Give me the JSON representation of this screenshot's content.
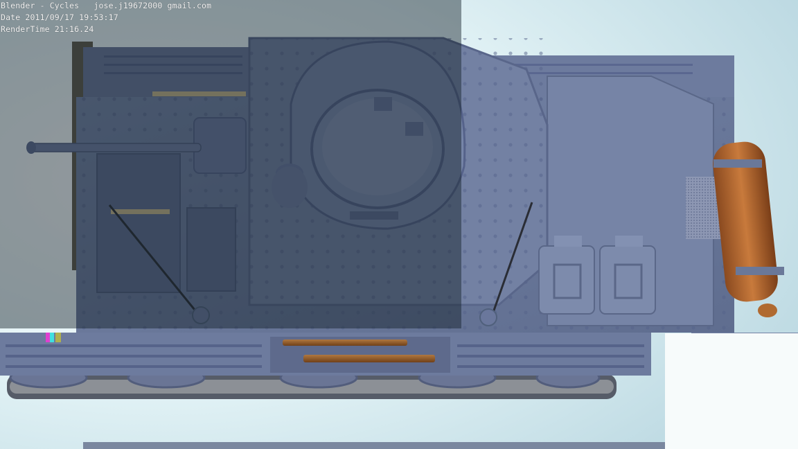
{
  "render_stamp": {
    "line1": "Blender - Cycles   jose.j19672000 gmail.com",
    "line2": "Date 2011/09/17 19:53:17",
    "line3": "RenderTime 21:16.24"
  },
  "colors": {
    "background": "#dff0f4",
    "hull": "#6b7a9c",
    "hull_dark": "#4f5c7c",
    "exhaust": "#b0612c",
    "wood": "#8e5a2c",
    "text": "#f4f4f4"
  }
}
